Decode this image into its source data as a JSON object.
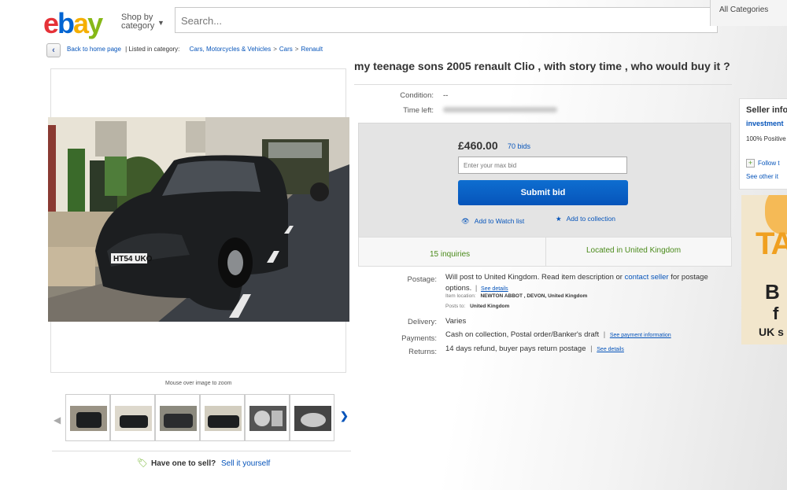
{
  "header": {
    "logo": {
      "e": "e",
      "b": "b",
      "a": "a",
      "y": "y"
    },
    "shop_by_line1": "Shop by",
    "shop_by_line2": "category",
    "search_placeholder": "Search...",
    "all_categories": "All Categories"
  },
  "breadcrumb": {
    "back_label": "Back to home page",
    "listed_in": "| Listed in category:",
    "items": [
      "Cars, Motorcycles & Vehicles",
      "Cars",
      "Renault"
    ]
  },
  "gallery": {
    "zoom_hint": "Mouse over image to zoom",
    "plate": "HT54 UKO",
    "thumbnail_count": 6
  },
  "sell": {
    "question": "Have one to sell?",
    "link": "Sell it yourself"
  },
  "item": {
    "title": "my teenage sons 2005 renault Clio , with story time , who would buy it ?",
    "condition_label": "Condition:",
    "condition_value": "--",
    "time_left_label": "Time left:",
    "price": "£460.00",
    "bids": "70 bids",
    "max_bid_placeholder": "Enter your max bid",
    "submit_label": "Submit bid",
    "watch_label": "Add to Watch list",
    "collection_label": "Add to collection",
    "inquiries": "15 inquiries",
    "located": "Located in United Kingdom"
  },
  "details": {
    "postage_label": "Postage:",
    "postage_text_1": "Will post to United Kingdom. Read item description or",
    "postage_contact": "contact seller",
    "postage_text_2": "for postage",
    "postage_text_3": "options.",
    "see_details": "See details",
    "item_location_label": "Item location:",
    "item_location": "NEWTON ABBOT , DEVON, United Kingdom",
    "posts_to_label": "Posts to:",
    "posts_to": "United Kingdom",
    "delivery_label": "Delivery:",
    "delivery_value": "Varies",
    "payments_label": "Payments:",
    "payments_value": "Cash on collection,  Postal order/Banker's draft",
    "see_payment": "See payment information",
    "returns_label": "Returns:",
    "returns_value": "14 days refund, buyer pays return postage",
    "see_details_2": "See details"
  },
  "seller": {
    "heading": "Seller info",
    "name": "investment",
    "positive": "100% Positive",
    "follow": "Follow t",
    "see_other": "See other it"
  },
  "ad": {
    "line1": "TA",
    "line2": "B",
    "line3": "f",
    "line4": "UK s"
  },
  "colors": {
    "ebay_red": "#e53238",
    "ebay_blue": "#0064d2",
    "ebay_yellow": "#f5af02",
    "ebay_green": "#86b817",
    "link": "#0654ba",
    "submit": "#0654ba",
    "location_green": "#4a8a1a"
  }
}
